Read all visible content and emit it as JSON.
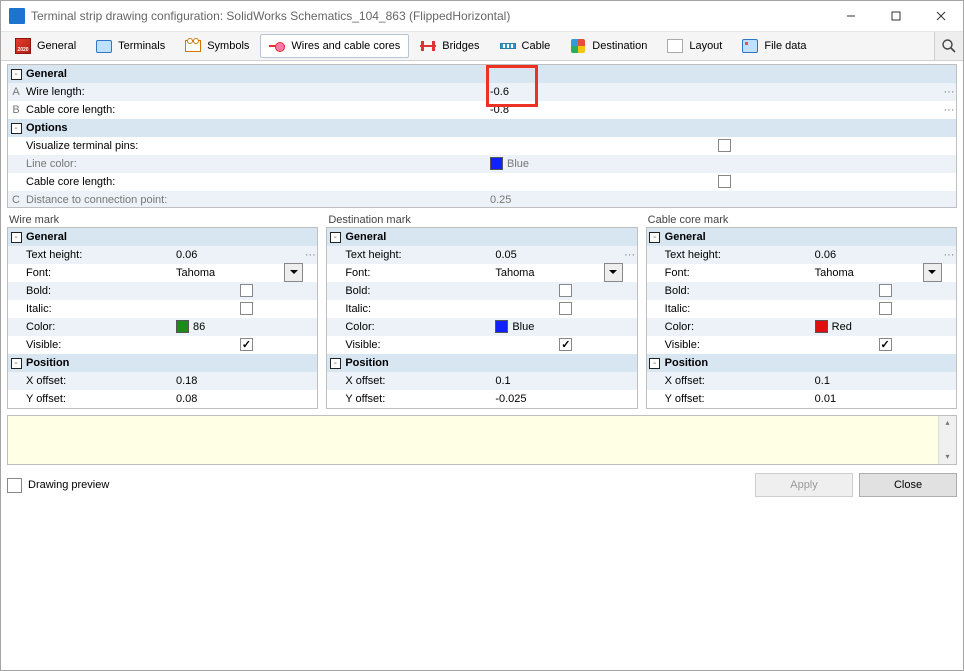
{
  "window": {
    "title": "Terminal strip drawing configuration: SolidWorks Schematics_104_863 (FlippedHorizontal)"
  },
  "tabs": {
    "general": "General",
    "terminals": "Terminals",
    "symbols": "Symbols",
    "wires": "Wires and cable cores",
    "bridges": "Bridges",
    "cable": "Cable",
    "destination": "Destination",
    "layout": "Layout",
    "filedata": "File data"
  },
  "top": {
    "hdr_general": "General",
    "wire_length_lbl": "Wire length:",
    "wire_length_val": "-0.6",
    "wire_length_gut": "A",
    "cable_core_len_lbl": "Cable core length:",
    "cable_core_len_val": "-0.8",
    "cable_core_len_gut": "B",
    "hdr_options": "Options",
    "vis_pins_lbl": "Visualize terminal pins:",
    "line_color_lbl": "Line color:",
    "line_color_name": "Blue",
    "line_color_hex": "#1020ff",
    "cc_len2_lbl": "Cable core length:",
    "dist_cp_lbl": "Distance to connection point:",
    "dist_cp_val": "0.25",
    "dist_cp_gut": "C"
  },
  "wiremark": {
    "title": "Wire mark",
    "hdr_general": "General",
    "hdr_position": "Position",
    "text_height_lbl": "Text height:",
    "text_height_val": "0.06",
    "font_lbl": "Font:",
    "font_val": "Tahoma",
    "bold_lbl": "Bold:",
    "italic_lbl": "Italic:",
    "color_lbl": "Color:",
    "color_name": "86",
    "color_hex": "#1c8b1c",
    "visible_lbl": "Visible:",
    "xoff_lbl": "X offset:",
    "xoff_val": "0.18",
    "yoff_lbl": "Y offset:",
    "yoff_val": "0.08"
  },
  "destmark": {
    "title": "Destination mark",
    "hdr_general": "General",
    "hdr_position": "Position",
    "text_height_lbl": "Text height:",
    "text_height_val": "0.05",
    "font_lbl": "Font:",
    "font_val": "Tahoma",
    "bold_lbl": "Bold:",
    "italic_lbl": "Italic:",
    "color_lbl": "Color:",
    "color_name": "Blue",
    "color_hex": "#1020ff",
    "visible_lbl": "Visible:",
    "xoff_lbl": "X offset:",
    "xoff_val": "0.1",
    "yoff_lbl": "Y offset:",
    "yoff_val": "-0.025"
  },
  "coremark": {
    "title": "Cable core mark",
    "hdr_general": "General",
    "hdr_position": "Position",
    "text_height_lbl": "Text height:",
    "text_height_val": "0.06",
    "font_lbl": "Font:",
    "font_val": "Tahoma",
    "bold_lbl": "Bold:",
    "italic_lbl": "Italic:",
    "color_lbl": "Color:",
    "color_name": "Red",
    "color_hex": "#e01010",
    "visible_lbl": "Visible:",
    "xoff_lbl": "X offset:",
    "xoff_val": "0.1",
    "yoff_lbl": "Y offset:",
    "yoff_val": "0.01"
  },
  "footer": {
    "preview": "Drawing preview",
    "apply": "Apply",
    "close": "Close"
  }
}
